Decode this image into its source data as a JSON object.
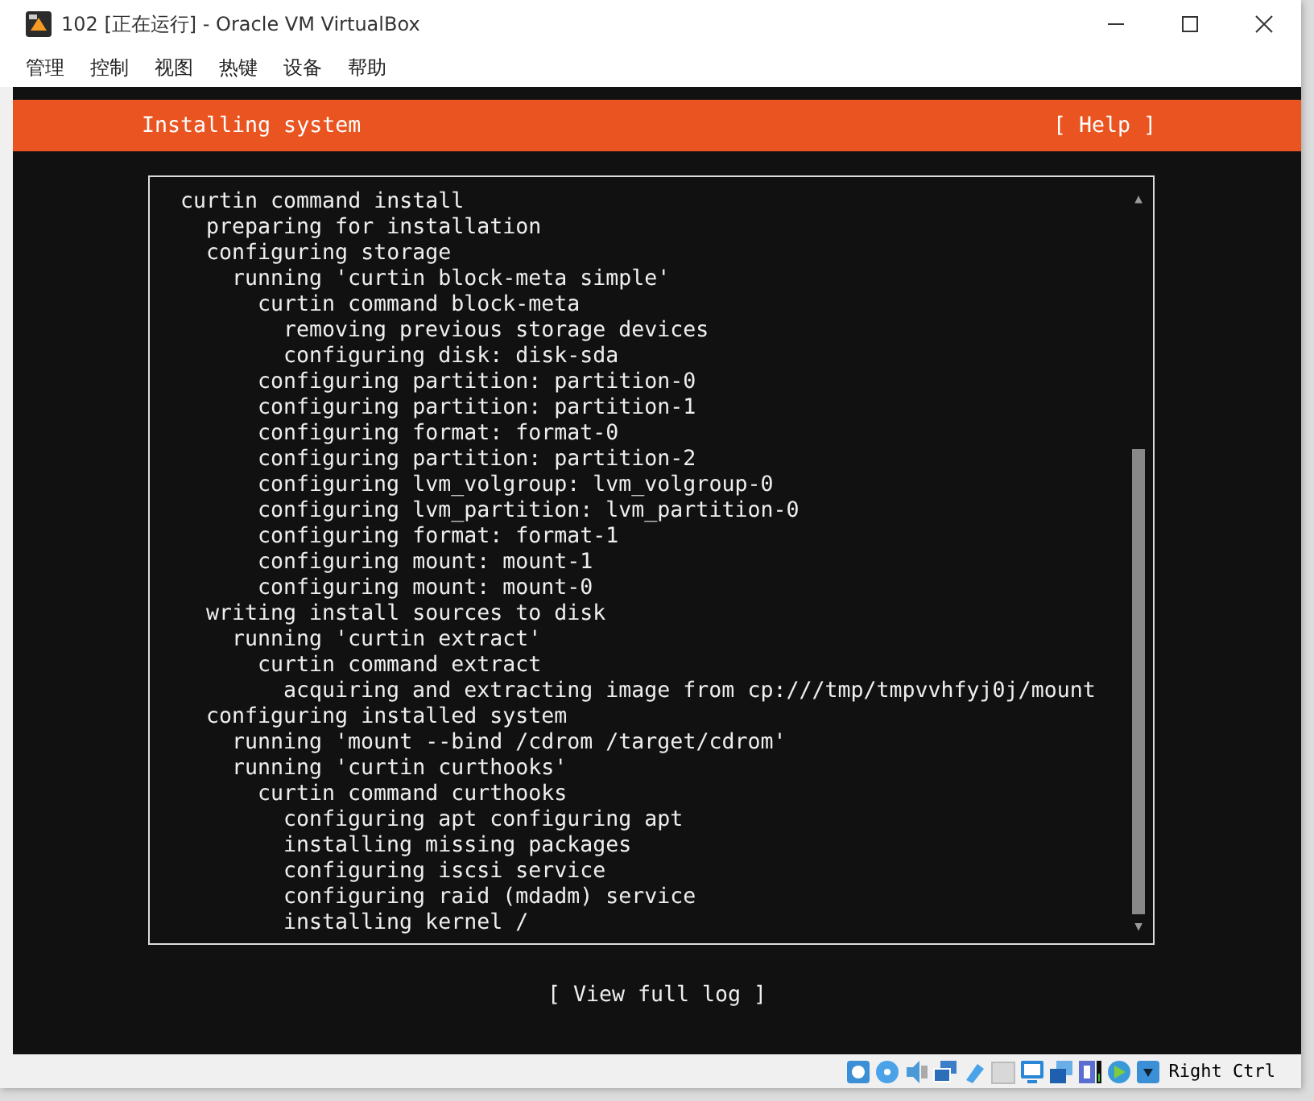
{
  "window": {
    "title": "102 [正在运行] - Oracle VM VirtualBox"
  },
  "menu": [
    "管理",
    "控制",
    "视图",
    "热键",
    "设备",
    "帮助"
  ],
  "header": {
    "title": "Installing system",
    "help": "[ Help ]"
  },
  "log": [
    {
      "text": "curtin command install",
      "children": [
        {
          "text": "preparing for installation"
        },
        {
          "text": "configuring storage",
          "children": [
            {
              "text": "running 'curtin block-meta simple'",
              "children": [
                {
                  "text": "curtin command block-meta",
                  "children": [
                    {
                      "text": "removing previous storage devices"
                    },
                    {
                      "text": "configuring disk: disk-sda"
                    }
                  ]
                },
                {
                  "text": "configuring partition: partition-0"
                },
                {
                  "text": "configuring partition: partition-1"
                },
                {
                  "text": "configuring format: format-0"
                },
                {
                  "text": "configuring partition: partition-2"
                },
                {
                  "text": "configuring lvm_volgroup: lvm_volgroup-0"
                },
                {
                  "text": "configuring lvm_partition: lvm_partition-0"
                },
                {
                  "text": "configuring format: format-1"
                },
                {
                  "text": "configuring mount: mount-1"
                },
                {
                  "text": "configuring mount: mount-0"
                }
              ]
            }
          ]
        },
        {
          "text": "writing install sources to disk",
          "children": [
            {
              "text": "running 'curtin extract'",
              "children": [
                {
                  "text": "curtin command extract",
                  "children": [
                    {
                      "text": "acquiring and extracting image from cp:///tmp/tmpvvhfyj0j/mount"
                    }
                  ]
                }
              ]
            }
          ]
        },
        {
          "text": "configuring installed system",
          "children": [
            {
              "text": "running 'mount --bind /cdrom /target/cdrom'"
            },
            {
              "text": "running 'curtin curthooks'",
              "children": [
                {
                  "text": "curtin command curthooks",
                  "children": [
                    {
                      "text": "configuring apt configuring apt"
                    },
                    {
                      "text": "installing missing packages"
                    },
                    {
                      "text": "configuring iscsi service"
                    },
                    {
                      "text": "configuring raid (mdadm) service"
                    },
                    {
                      "text": "installing kernel /"
                    }
                  ]
                }
              ]
            }
          ]
        }
      ]
    }
  ],
  "scroll": {
    "up": "▲",
    "down": "▼"
  },
  "view_log": "[ View full log ]",
  "status_bar": {
    "host_key": "Right Ctrl"
  }
}
